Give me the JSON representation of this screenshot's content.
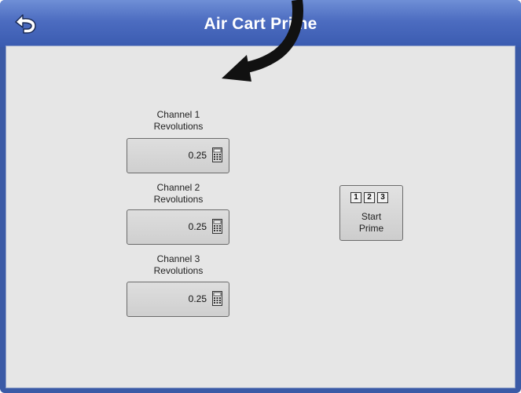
{
  "header": {
    "title": "Air Cart Prime",
    "back_icon": "back-arrow-icon"
  },
  "channels": [
    {
      "label_line1": "Channel 1",
      "label_line2": "Revolutions",
      "value": "0.25",
      "icon": "calculator-icon"
    },
    {
      "label_line1": "Channel 2",
      "label_line2": "Revolutions",
      "value": "0.25",
      "icon": "calculator-icon"
    },
    {
      "label_line1": "Channel 3",
      "label_line2": "Revolutions",
      "value": "0.25",
      "icon": "calculator-icon"
    }
  ],
  "start_prime": {
    "numbers": [
      "1",
      "2",
      "3"
    ],
    "label_line1": "Start",
    "label_line2": "Prime"
  },
  "annotation": {
    "icon": "curved-arrow-icon",
    "color": "#111111"
  },
  "colors": {
    "titlebar": "#4c6cc0",
    "frame": "#3b5aa6",
    "content_bg": "#e6e6e6"
  }
}
